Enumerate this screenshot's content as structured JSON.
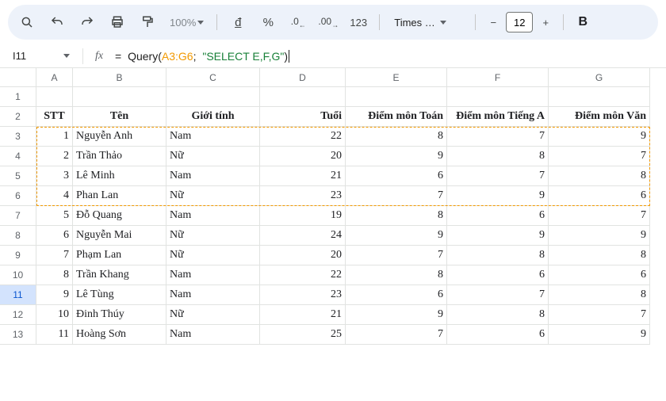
{
  "toolbar": {
    "zoom": "100%",
    "font_name": "Times …",
    "font_size": "12",
    "bold": "B"
  },
  "namebox": "I11",
  "formula": {
    "func": "Query",
    "range": "A3:G6",
    "str": "\"SELECT E,F,G\""
  },
  "columns": [
    "A",
    "B",
    "C",
    "D",
    "E",
    "F",
    "G"
  ],
  "row_labels": [
    "1",
    "2",
    "3",
    "4",
    "5",
    "6",
    "7",
    "8",
    "9",
    "10",
    "11",
    "12",
    "13"
  ],
  "headers": {
    "stt": "STT",
    "ten": "Tên",
    "gioitinh": "Giới tính",
    "tuoi": "Tuổi",
    "diemtoan": "Điểm môn Toán",
    "diemanh": "Điểm môn Tiếng A",
    "diemvan": "Điểm môn Văn"
  },
  "rows": [
    {
      "stt": "1",
      "ten": "Nguyễn Anh",
      "gt": "Nam",
      "tuoi": "22",
      "t": "8",
      "a": "7",
      "v": "9"
    },
    {
      "stt": "2",
      "ten": "Trần Thảo",
      "gt": "Nữ",
      "tuoi": "20",
      "t": "9",
      "a": "8",
      "v": "7"
    },
    {
      "stt": "3",
      "ten": "Lê Minh",
      "gt": "Nam",
      "tuoi": "21",
      "t": "6",
      "a": "7",
      "v": "8"
    },
    {
      "stt": "4",
      "ten": "Phan Lan",
      "gt": "Nữ",
      "tuoi": "23",
      "t": "7",
      "a": "9",
      "v": "6"
    },
    {
      "stt": "5",
      "ten": "Đỗ Quang",
      "gt": "Nam",
      "tuoi": "19",
      "t": "8",
      "a": "6",
      "v": "7"
    },
    {
      "stt": "6",
      "ten": "Nguyễn Mai",
      "gt": "Nữ",
      "tuoi": "24",
      "t": "9",
      "a": "9",
      "v": "9"
    },
    {
      "stt": "7",
      "ten": "Phạm Lan",
      "gt": "Nữ",
      "tuoi": "20",
      "t": "7",
      "a": "8",
      "v": "8"
    },
    {
      "stt": "8",
      "ten": "Trần Khang",
      "gt": "Nam",
      "tuoi": "22",
      "t": "8",
      "a": "6",
      "v": "6"
    },
    {
      "stt": "9",
      "ten": "Lê Tùng",
      "gt": "Nam",
      "tuoi": "23",
      "t": "6",
      "a": "7",
      "v": "8"
    },
    {
      "stt": "10",
      "ten": "Đinh Thúy",
      "gt": "Nữ",
      "tuoi": "21",
      "t": "9",
      "a": "8",
      "v": "7"
    },
    {
      "stt": "11",
      "ten": "Hoàng Sơn",
      "gt": "Nam",
      "tuoi": "25",
      "t": "7",
      "a": "6",
      "v": "9"
    }
  ]
}
